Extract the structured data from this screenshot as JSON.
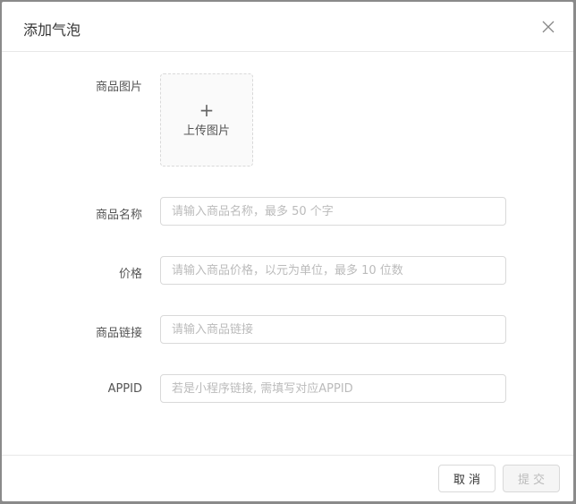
{
  "dialog": {
    "title": "添加气泡",
    "close_icon": "close-icon"
  },
  "form": {
    "image": {
      "label": "商品图片",
      "upload_icon": "plus-icon",
      "upload_text": "上传图片"
    },
    "name": {
      "label": "商品名称",
      "value": "",
      "placeholder": "请输入商品名称，最多 50 个字"
    },
    "price": {
      "label": "价格",
      "value": "",
      "placeholder": "请输入商品价格，以元为单位，最多 10 位数"
    },
    "link": {
      "label": "商品链接",
      "value": "",
      "placeholder": "请输入商品链接"
    },
    "appid": {
      "label": "APPID",
      "value": "",
      "placeholder": "若是小程序链接, 需填写对应APPID"
    }
  },
  "footer": {
    "cancel_label": "取消",
    "submit_label": "提交"
  }
}
